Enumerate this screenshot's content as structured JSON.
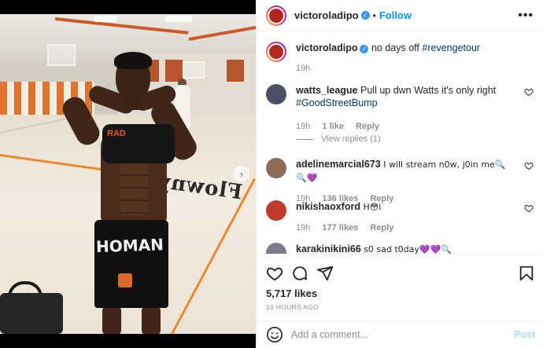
{
  "post": {
    "author": "victoroladipo",
    "follow_label": "Follow",
    "dot": "•",
    "more_icon": "more-horizontal-icon",
    "caption_text": "no days off",
    "caption_hashtag": "#revengetour",
    "caption_time": "19h",
    "image_text": {
      "court": "Flowny",
      "shorts": "HOMAN",
      "shirt": "RAD"
    }
  },
  "comments": [
    {
      "username": "watts_league",
      "text": "Pull up dwn Watts it's only right",
      "hashtag": "#GoodStreetBump",
      "time": "19h",
      "likes": "1 like",
      "reply": "Reply",
      "view_replies": "View replies (1)",
      "avatar_color": "#5a5a6a"
    },
    {
      "username": "adelinemarcial673",
      "text": "I will stream n0w, j0in me🔍🔍💜",
      "time": "19h",
      "likes": "136 likes",
      "reply": "Reply",
      "avatar_color": "#8a6a5a"
    },
    {
      "username": "nikishaoxford",
      "text": "H😳i",
      "time": "19h",
      "likes": "177 likes",
      "reply": "Reply",
      "avatar_color": "#c0392b"
    },
    {
      "username": "karakinikini66",
      "text": "s0 sad t0day💜💜🔍",
      "avatar_color": "#7a7a8a"
    }
  ],
  "actions": {
    "like_icon": "heart-icon",
    "comment_icon": "comment-bubble-icon",
    "share_icon": "share-plane-icon",
    "save_icon": "bookmark-icon"
  },
  "likes_count": "5,717 likes",
  "timestamp": "19 HOURS AGO",
  "add_comment": {
    "placeholder": "Add a comment...",
    "post_label": "Post",
    "emoji_icon": "emoji-smile-icon"
  },
  "colors": {
    "link": "#0095f6",
    "hashtag": "#00376b",
    "muted": "#8e8e8e",
    "post_disabled": "#b3dbff",
    "verified": "#3897f0"
  }
}
